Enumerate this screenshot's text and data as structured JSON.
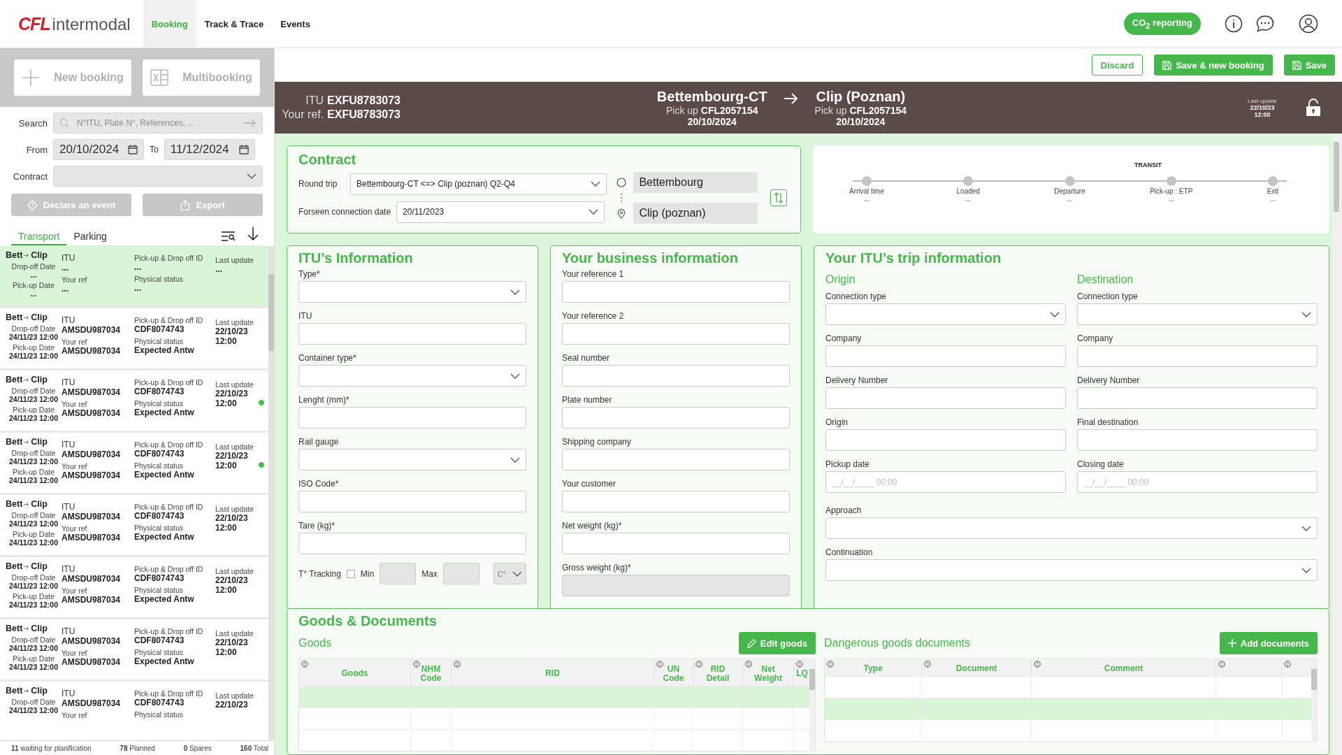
{
  "nav": {
    "logo_brand": "CFL",
    "logo_text": "intermodal",
    "items": [
      {
        "label": "Booking",
        "selected": true
      },
      {
        "label": "Track & Trace",
        "selected": false
      },
      {
        "label": "Events",
        "selected": false
      }
    ],
    "co2_button": "CO$_{2}$ reporting"
  },
  "sidebar": {
    "new_booking": "New booking",
    "multibooking": "Multibooking",
    "search_label": "Search",
    "search_placeholder": "N°ITU, Plate N°, References, ...",
    "from_label": "From",
    "from_value": "20/10/2024",
    "to_label": "To",
    "to_value": "11/12/2024",
    "contract_label": "Contract",
    "declare_button": "Declare an event",
    "export_button": "Export",
    "tabs": [
      {
        "label": "Transport",
        "selected": true
      },
      {
        "label": "Parking",
        "selected": false
      }
    ],
    "items": [
      {
        "selected": true,
        "dot": false,
        "route_from": "Bett",
        "route_to": "Clip",
        "dropoff_label": "Drop-off Date",
        "dropoff": "...",
        "pickup_label": "Pick-up Date",
        "pickup": "...",
        "itu_label": "ITU",
        "itu": "...",
        "ref_label": "Your ref",
        "ref": "...",
        "id_label": "Pick-up & Drop off ID",
        "id": "...",
        "status_label": "Physical status",
        "status": "...",
        "update_label": "Last update",
        "update": "..."
      },
      {
        "selected": false,
        "dot": false,
        "route_from": "Bett",
        "route_to": "Clip",
        "dropoff_label": "Drop-off Date",
        "dropoff": "24/11/23 12:00",
        "pickup_label": "Pick-up Date",
        "pickup": "24/11/23 12:00",
        "itu_label": "ITU",
        "itu": "AMSDU987034",
        "ref_label": "Your ref",
        "ref": "AMSDU987034",
        "id_label": "Pick-up & Drop off ID",
        "id": "CDF8074743",
        "status_label": "Physical status",
        "status": "Expected Antw",
        "update_label": "Last update",
        "update": "22/10/23 12:00"
      },
      {
        "selected": false,
        "dot": true,
        "route_from": "Bett",
        "route_to": "Clip",
        "dropoff_label": "Drop-off Date",
        "dropoff": "24/11/23 12:00",
        "pickup_label": "Pick-up Date",
        "pickup": "24/11/23 12:00",
        "itu_label": "ITU",
        "itu": "AMSDU987034",
        "ref_label": "Your ref",
        "ref": "AMSDU987034",
        "id_label": "Pick-up & Drop off ID",
        "id": "CDF8074743",
        "status_label": "Physical status",
        "status": "Expected Antw",
        "update_label": "Last update",
        "update": "22/10/23 12:00"
      },
      {
        "selected": false,
        "dot": true,
        "route_from": "Bett",
        "route_to": "Clip",
        "dropoff_label": "Drop-off Date",
        "dropoff": "24/11/23 12:00",
        "pickup_label": "Pick-up Date",
        "pickup": "24/11/23 12:00",
        "itu_label": "ITU",
        "itu": "AMSDU987034",
        "ref_label": "Your ref",
        "ref": "AMSDU987034",
        "id_label": "Pick-up & Drop off ID",
        "id": "CDF8074743",
        "status_label": "Physical status",
        "status": "Expected Antw",
        "update_label": "Last update",
        "update": "22/10/23 12:00"
      },
      {
        "selected": false,
        "dot": false,
        "route_from": "Bett",
        "route_to": "Clip",
        "dropoff_label": "Drop-off Date",
        "dropoff": "24/11/23 12:00",
        "pickup_label": "Pick-up Date",
        "pickup": "24/11/23 12:00",
        "itu_label": "ITU",
        "itu": "AMSDU987034",
        "ref_label": "Your ref",
        "ref": "AMSDU987034",
        "id_label": "Pick-up & Drop off ID",
        "id": "CDF8074743",
        "status_label": "Physical status",
        "status": "Expected Antw",
        "update_label": "Last update",
        "update": "22/10/23 12:00"
      },
      {
        "selected": false,
        "dot": false,
        "route_from": "Bett",
        "route_to": "Clip",
        "dropoff_label": "Drop-off Date",
        "dropoff": "24/11/23 12:00",
        "pickup_label": "Pick-up Date",
        "pickup": "24/11/23 12:00",
        "itu_label": "ITU",
        "itu": "AMSDU987034",
        "ref_label": "Your ref",
        "ref": "AMSDU987034",
        "id_label": "Pick-up & Drop off ID",
        "id": "CDF8074743",
        "status_label": "Physical status",
        "status": "Expected Antw",
        "update_label": "Last update",
        "update": "22/10/23 12:00"
      },
      {
        "selected": false,
        "dot": false,
        "route_from": "Bett",
        "route_to": "Clip",
        "dropoff_label": "Drop-off Date",
        "dropoff": "24/11/23 12:00",
        "pickup_label": "Pick-up Date",
        "pickup": "24/11/23 12:00",
        "itu_label": "ITU",
        "itu": "AMSDU987034",
        "ref_label": "Your ref",
        "ref": "AMSDU987034",
        "id_label": "Pick-up & Drop off ID",
        "id": "CDF8074743",
        "status_label": "Physical status",
        "status": "Expected Antw",
        "update_label": "Last update",
        "update": "22/10/23 12:00"
      },
      {
        "selected": false,
        "dot": false,
        "route_from": "Bett",
        "route_to": "Clip",
        "dropoff_label": "Drop-off Date",
        "dropoff": "24/11/23 12:00",
        "itu_label": "ITU",
        "itu": "AMSDU987034",
        "ref_label": "Your ref",
        "id_label": "Pick-up & Drop off ID",
        "id": "CDF8074743",
        "status_label": "Physical status",
        "update_label": "Last update",
        "update": "22/10/23"
      }
    ],
    "status_bar": [
      "**11** waiting for planification",
      "**78** Planned",
      "**0** Spares",
      "**160** Total"
    ]
  },
  "actions": {
    "discard": "Discard",
    "save_new": "Save & new booking",
    "save": "Save"
  },
  "header": {
    "itu_label": "ITU",
    "itu": "EXFU8783073",
    "ref_label": "Your ref.",
    "ref": "EXFU8783073",
    "from": {
      "name": "Bettembourg-CT",
      "pickup_label": "Pick up",
      "pickup": "CFL2057154",
      "date": "20/10/2024"
    },
    "to": {
      "name": "Clip (Poznan)",
      "pickup_label": "Pick up",
      "pickup": "CFL2057154",
      "date": "20/10/2024"
    },
    "last_update_label": "Last update",
    "last_update": "22/10/23 12:00"
  },
  "contract": {
    "title": "Contract",
    "round_trip_label": "Round trip",
    "round_trip": "Bettembourg-CT <=> Clip (poznan) Q2-Q4",
    "connection_label": "Forseen connection date",
    "connection": "20/11/2023",
    "origin": "Bettembourg",
    "destination": "Clip (poznan)"
  },
  "transit": {
    "label": "TRANSIT",
    "steps": [
      {
        "label": "Arrival time",
        "value": "..."
      },
      {
        "label": "Loaded",
        "value": "..."
      },
      {
        "label": "Departure",
        "value": "..."
      },
      {
        "label": "Pick-up : ETP",
        "value": "..."
      },
      {
        "label": "Exit",
        "value": "..."
      }
    ]
  },
  "itu_info": {
    "title": "ITU’s Information",
    "fields": [
      {
        "label": "Type*",
        "kind": "select"
      },
      {
        "label": "ITU",
        "kind": "text"
      },
      {
        "label": "Container type*",
        "kind": "select"
      },
      {
        "label": "Lenght (mm)*",
        "kind": "text"
      },
      {
        "label": "Rail gauge",
        "kind": "select"
      },
      {
        "label": "ISO Code*",
        "kind": "text"
      },
      {
        "label": "Tare (kg)*",
        "kind": "text"
      }
    ],
    "tracking": {
      "label": "T° Tracking",
      "checked": false,
      "min_label": "Min",
      "max_label": "Max",
      "unit": "C°"
    }
  },
  "business": {
    "title": "Your business information",
    "fields": [
      {
        "label": "Your reference 1",
        "kind": "text"
      },
      {
        "label": "Your reference 2",
        "kind": "text"
      },
      {
        "label": "Seal number",
        "kind": "text"
      },
      {
        "label": "Plate number",
        "kind": "text"
      },
      {
        "label": "Shipping company",
        "kind": "text"
      },
      {
        "label": "Your customer",
        "kind": "text"
      },
      {
        "label": "Net weight (kg)*",
        "kind": "text"
      },
      {
        "label": "Gross weight (kg)*",
        "kind": "readonly"
      }
    ]
  },
  "trip": {
    "title": "Your ITU’s trip information",
    "origin_title": "Origin",
    "destination_title": "Destination",
    "origin_fields": [
      {
        "label": "Connection type",
        "kind": "select"
      },
      {
        "label": "Company",
        "kind": "text"
      },
      {
        "label": "Delivery Number",
        "kind": "text"
      },
      {
        "label": "Origin",
        "kind": "text"
      },
      {
        "label": "Pickup date",
        "kind": "date",
        "placeholder": "__/__/____ 00:00"
      }
    ],
    "destination_fields": [
      {
        "label": "Connection type",
        "kind": "select"
      },
      {
        "label": "Company",
        "kind": "text"
      },
      {
        "label": "Delivery Number",
        "kind": "text"
      },
      {
        "label": "Final destination",
        "kind": "text"
      },
      {
        "label": "Closing date",
        "kind": "date",
        "placeholder": "__/__/____ 00:00"
      }
    ],
    "wide_fields": [
      {
        "label": "Approach",
        "kind": "select"
      },
      {
        "label": "Continuation",
        "kind": "select"
      }
    ]
  },
  "goods": {
    "title": "Goods & Documents",
    "goods_title": "Goods",
    "edit_button": "Edit goods",
    "goods_columns": [
      {
        "label": "Goods"
      },
      {
        "label": "NHM Code"
      },
      {
        "label": "RID"
      },
      {
        "label": "UN Code"
      },
      {
        "label": "RID Detail"
      },
      {
        "label": "Net Weight"
      },
      {
        "label": "LQ"
      }
    ],
    "goods_rows": [
      {
        "selected": true
      },
      {
        "selected": false
      },
      {
        "selected": false
      }
    ],
    "docs_title": "Dangerous goods documents",
    "add_button": "Add documents",
    "docs_columns": [
      {
        "label": "Type"
      },
      {
        "label": "Document"
      },
      {
        "label": "Comment"
      },
      {},
      {}
    ],
    "docs_rows": [
      {
        "selected": false
      },
      {
        "selected": true
      },
      {
        "selected": false
      }
    ]
  }
}
